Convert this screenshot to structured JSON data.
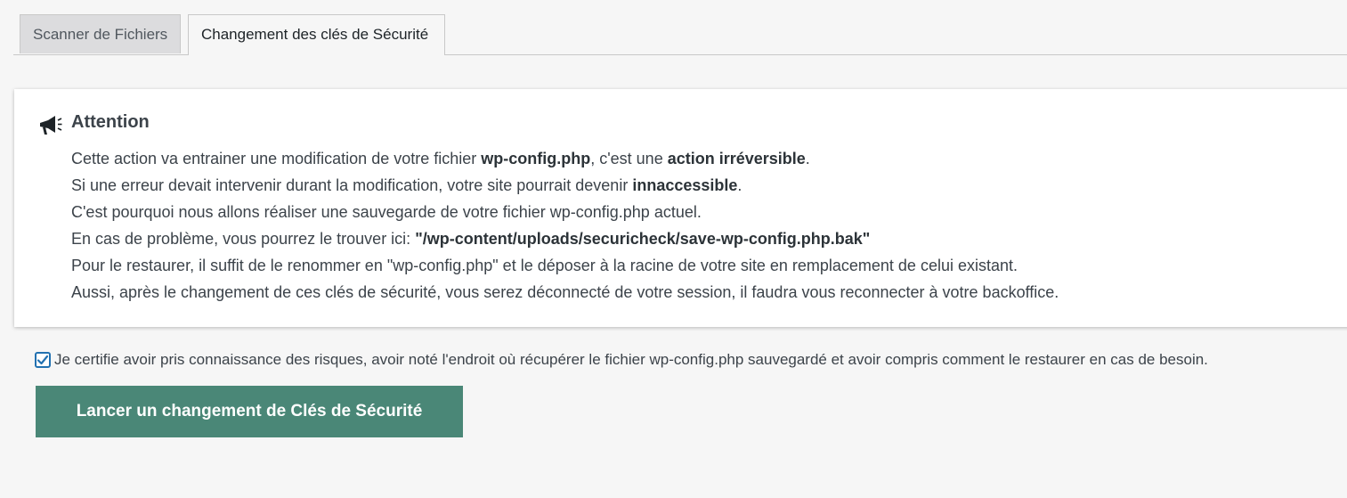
{
  "tabs": [
    {
      "label": "Scanner de Fichiers",
      "active": false
    },
    {
      "label": "Changement des clés de Sécurité",
      "active": true
    }
  ],
  "notice": {
    "icon": "megaphone-icon",
    "title": "Attention",
    "line1": {
      "pre": "Cette action va entrainer une modification de votre fichier ",
      "bold1": "wp-config.php",
      "mid": ", c'est une ",
      "bold2": "action irréversible",
      "post": "."
    },
    "line2": {
      "pre": "Si une erreur devait intervenir durant la modification, votre site pourrait devenir ",
      "bold": "innaccessible",
      "post": "."
    },
    "line3": "C'est pourquoi nous allons réaliser une sauvegarde de votre fichier wp-config.php actuel.",
    "line4": {
      "pre": "En cas de problème, vous pourrez le trouver ici: ",
      "bold": "\"/wp-content/uploads/securicheck/save-wp-config.php.bak\""
    },
    "line5": "Pour le restaurer, il suffit de le renommer en \"wp-config.php\" et le déposer à la racine de votre site en remplacement de celui existant.",
    "line6": "Aussi, après le changement de ces clés de sécurité, vous serez déconnecté de votre session, il faudra vous reconnecter à votre backoffice."
  },
  "certify": {
    "checked": true,
    "label": "Je certifie avoir pris connaissance des risques, avoir noté l'endroit où récupérer le fichier wp-config.php sauvegardé et avoir compris comment le restaurer en cas de besoin."
  },
  "launch_button": {
    "label": "Lancer un changement de Clés de Sécurité"
  },
  "colors": {
    "accent_button": "#4a8777",
    "checkbox_border": "#2271b1",
    "background": "#f6f6f6"
  }
}
